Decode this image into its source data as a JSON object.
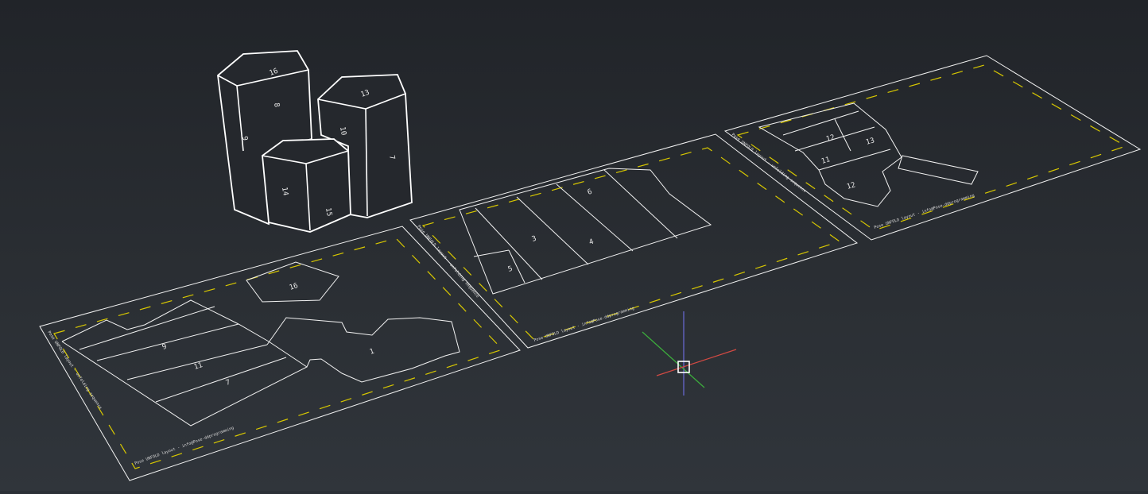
{
  "viewport": {
    "background_top": "#212429",
    "background_bottom": "#30353b",
    "ucs_colors": {
      "x": "#d24a43",
      "y": "#3cae3c",
      "z": "#6b6bd8"
    }
  },
  "sheets": [
    {
      "footer": "Pose UNFOLD layout - info@Pose-ddprogramming",
      "side": "Pose UNFOLD layout - unfolding sequence"
    },
    {
      "footer": "Pose UNFOLD layout - info@Pose-ddprogramming",
      "side": "Pose UNFOLD layout - unfolding sequence"
    },
    {
      "footer": "Pose UNFOLD layout - info@Pose-ddprogramming",
      "side": "Pose UNFOLD layout - unfolding sequence"
    }
  ],
  "model_labels": {
    "face_a": "9",
    "face_b": "8",
    "face_c": "10",
    "face_d": "7",
    "face_e": "14",
    "face_f": "15",
    "top_a": "16",
    "top_b": "13"
  },
  "sheet1_labels": {
    "l1": "9",
    "l2": "11",
    "l3": "7",
    "l4": "16",
    "l5": "1"
  },
  "sheet2_labels": {
    "l1": "3",
    "l2": "4",
    "l3": "6",
    "l4": "5"
  },
  "sheet3_labels": {
    "l1": "12",
    "l2": "13",
    "l3": "11",
    "l4": "12"
  }
}
